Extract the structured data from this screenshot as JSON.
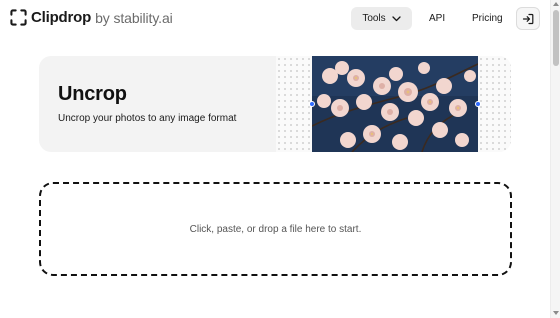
{
  "header": {
    "logo_name": "Clipdrop",
    "logo_by": "by stability.ai",
    "nav": {
      "tools_label": "Tools",
      "api_label": "API",
      "pricing_label": "Pricing"
    },
    "login_icon": "login-icon"
  },
  "hero": {
    "title": "Uncrop",
    "subtitle": "Uncrop your photos to any image format",
    "image_subject": "pink blossoms on dark blue background"
  },
  "dropzone": {
    "text": "Click, paste, or drop a file here to start."
  },
  "colors": {
    "accent_handle": "#2f6bff",
    "hero_bg": "#f3f3f3",
    "tools_bg": "#ececec"
  }
}
